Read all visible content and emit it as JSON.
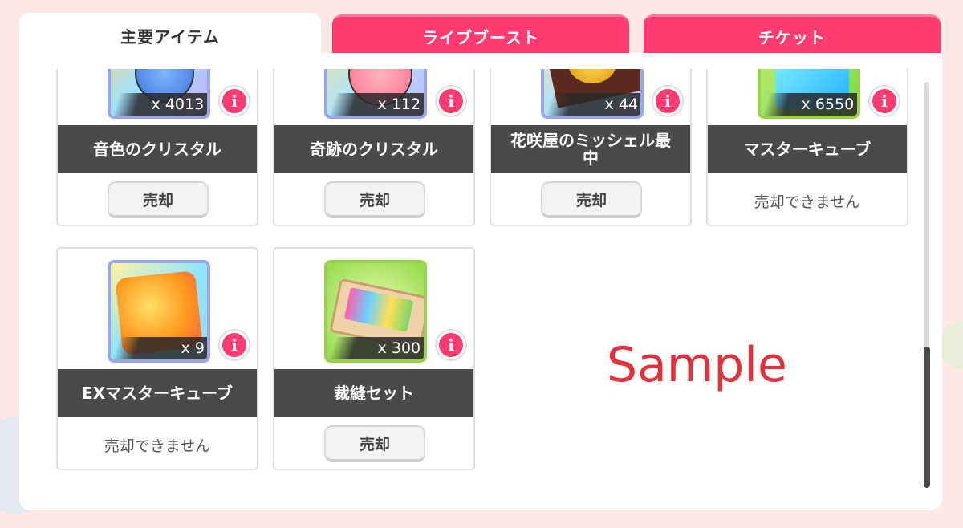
{
  "tabs": [
    {
      "label": "主要アイテム",
      "active": true
    },
    {
      "label": "ライブブースト",
      "active": false
    },
    {
      "label": "チケット",
      "active": false
    }
  ],
  "items": [
    {
      "name": "音色のクリスタル",
      "quantity": "x 4013",
      "sell": "売却",
      "sellable": true
    },
    {
      "name": "奇跡のクリスタル",
      "quantity": "x 112",
      "sell": "売却",
      "sellable": true
    },
    {
      "name": "花咲屋のミッシェル最中",
      "quantity": "x 44",
      "sell": "売却",
      "sellable": true
    },
    {
      "name": "マスターキューブ",
      "quantity": "x 6550",
      "sell": "売却できません",
      "sellable": false
    },
    {
      "name": "EXマスターキューブ",
      "quantity": "x 9",
      "sell": "売却できません",
      "sellable": false
    },
    {
      "name": "裁縫セット",
      "quantity": "x 300",
      "sell": "売却",
      "sellable": true
    }
  ],
  "info_glyph": "i",
  "watermark": "Sample",
  "colors": {
    "accent": "#ff3b6f",
    "name_bar": "#4a4a4a"
  },
  "icons": [
    "music-crystal-icon",
    "miracle-crystal-icon",
    "monaka-icon",
    "master-cube-icon",
    "ex-master-cube-icon",
    "sewing-set-icon",
    "info-icon"
  ]
}
